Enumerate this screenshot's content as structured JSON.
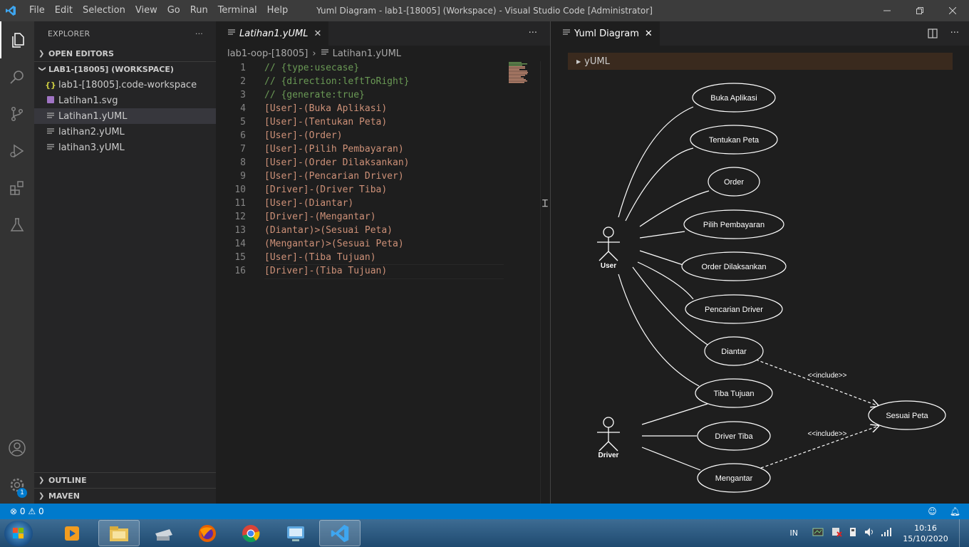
{
  "window": {
    "title": "Yuml Diagram - lab1-[18005] (Workspace) - Visual Studio Code [Administrator]",
    "menu": [
      "File",
      "Edit",
      "Selection",
      "View",
      "Go",
      "Run",
      "Terminal",
      "Help"
    ]
  },
  "sidebar": {
    "title": "EXPLORER",
    "more": "···",
    "open_editors": "OPEN EDITORS",
    "workspace": "LAB1-[18005] (WORKSPACE)",
    "files": [
      {
        "name": "lab1-[18005].code-workspace",
        "icon": "json-braces-icon"
      },
      {
        "name": "Latihan1.svg",
        "icon": "svg-file-icon"
      },
      {
        "name": "Latihan1.yUML",
        "icon": "text-file-icon"
      },
      {
        "name": "latihan2.yUML",
        "icon": "text-file-icon"
      },
      {
        "name": "latihan3.yUML",
        "icon": "text-file-icon"
      }
    ],
    "outline": "OUTLINE",
    "maven": "MAVEN"
  },
  "editor": {
    "tab_label": "Latihan1.yUML",
    "breadcrumb_folder": "lab1-oop-[18005]",
    "breadcrumb_file": "Latihan1.yUML",
    "more": "···",
    "lines": [
      {
        "n": "1",
        "text": "// {type:usecase}",
        "kind": "comment"
      },
      {
        "n": "2",
        "text": "// {direction:leftToRight}",
        "kind": "comment"
      },
      {
        "n": "3",
        "text": "// {generate:true}",
        "kind": "comment"
      },
      {
        "n": "4",
        "text": "[User]-(Buka Aplikasi)",
        "kind": "code"
      },
      {
        "n": "5",
        "text": "[User]-(Tentukan Peta)",
        "kind": "code"
      },
      {
        "n": "6",
        "text": "[User]-(Order)",
        "kind": "code"
      },
      {
        "n": "7",
        "text": "[User]-(Pilih Pembayaran)",
        "kind": "code"
      },
      {
        "n": "8",
        "text": "[User]-(Order Dilaksankan)",
        "kind": "code"
      },
      {
        "n": "9",
        "text": "[User]-(Pencarian Driver)",
        "kind": "code"
      },
      {
        "n": "10",
        "text": "[Driver]-(Driver Tiba)",
        "kind": "code"
      },
      {
        "n": "11",
        "text": "[User]-(Diantar)",
        "kind": "code"
      },
      {
        "n": "12",
        "text": "[Driver]-(Mengantar)",
        "kind": "code"
      },
      {
        "n": "13",
        "text": "(Diantar)>(Sesuai Peta)",
        "kind": "code"
      },
      {
        "n": "14",
        "text": "(Mengantar)>(Sesuai Peta)",
        "kind": "code"
      },
      {
        "n": "15",
        "text": "[User]-(Tiba Tujuan)",
        "kind": "code"
      },
      {
        "n": "16",
        "text": "[Driver]-(Tiba Tujuan)",
        "kind": "code"
      }
    ]
  },
  "preview": {
    "tab_label": "Yuml Diagram",
    "details_label": "yUML",
    "actors": [
      "User",
      "Driver"
    ],
    "usecases": [
      "Buka Aplikasi",
      "Tentukan Peta",
      "Order",
      "Pilih Pembayaran",
      "Order Dilaksankan",
      "Pencarian Driver",
      "Diantar",
      "Tiba Tujuan",
      "Driver Tiba",
      "Mengantar",
      "Sesuai Peta"
    ],
    "include_label": "<<include>>"
  },
  "statusbar": {
    "errors": "0",
    "warnings": "0"
  },
  "taskbar": {
    "input_lang": "IN",
    "time": "10:16",
    "date": "15/10/2020"
  },
  "colors": {
    "accent": "#007acc",
    "comment": "#6a9955",
    "string": "#ce9178"
  }
}
